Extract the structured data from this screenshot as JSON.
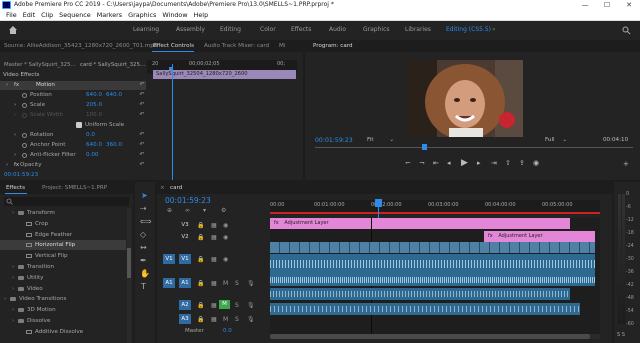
{
  "window": {
    "title": "Adobe Premiere Pro CC 2019 - C:\\Users\\jaypa\\Documents\\Adobe\\Premiere Pro\\13.0\\SMELLS~1.PRP.prproj *",
    "minimize": "—",
    "maximize": "☐",
    "close": "✕"
  },
  "menu": [
    "File",
    "Edit",
    "Clip",
    "Sequence",
    "Markers",
    "Graphics",
    "Window",
    "Help"
  ],
  "workspaces": [
    "Learning",
    "Assembly",
    "Editing",
    "Color",
    "Effects",
    "Audio",
    "Graphics",
    "Libraries",
    "Editing (CS5.5)"
  ],
  "source_panel": {
    "tabs": [
      "Source: AllieAddison_35423_1280x720_2600_T01.mp4",
      "Effect Controls",
      "Audio Track Mixer: card",
      "Mi"
    ],
    "master": "Master * SallySquirt_325...",
    "clip": "card * SallySquirt_325...",
    "time_start": "20",
    "time_mid": "00;00;02;05",
    "time_end": "00;",
    "clip_bar": "SallySquirt_32504_1280x720_2600",
    "section": "Video Effects",
    "fx_motion": "Motion",
    "position_label": "Position",
    "position_x": "640.0",
    "position_y": "640.0",
    "scale_label": "Scale",
    "scale_val": "205.0",
    "scale_width_label": "Scale Width",
    "scale_width_val": "100.0",
    "uniform_scale": "Uniform Scale",
    "rotation_label": "Rotation",
    "rotation_val": "0.0",
    "anchor_label": "Anchor Point",
    "anchor_x": "640.0",
    "anchor_y": "360.0",
    "flicker_label": "Anti-flicker Filter",
    "flicker_val": "0.00",
    "opacity_label": "Opacity",
    "timecode": "00:01:59:23"
  },
  "program_panel": {
    "title": "Program: card",
    "timecode": "00:01:59:23",
    "fit": "Fit",
    "quality": "Full",
    "duration": "00:04:10"
  },
  "effects_panel": {
    "tabs": [
      "Effects",
      "Project: SMELLS~1.PRP"
    ],
    "items": [
      {
        "label": "Transform",
        "level": 1,
        "folder": true
      },
      {
        "label": "Crop",
        "level": 2
      },
      {
        "label": "Edge Feather",
        "level": 2
      },
      {
        "label": "Horizontal Flip",
        "level": 2,
        "selected": true
      },
      {
        "label": "Vertical Flip",
        "level": 2
      },
      {
        "label": "Transition",
        "level": 1,
        "folder": true
      },
      {
        "label": "Utility",
        "level": 1,
        "folder": true
      },
      {
        "label": "Video",
        "level": 1,
        "folder": true
      },
      {
        "label": "Video Transitions",
        "level": 0,
        "folder": true
      },
      {
        "label": "3D Motion",
        "level": 1,
        "folder": true
      },
      {
        "label": "Dissolve",
        "level": 1,
        "folder": true
      },
      {
        "label": "Additive Dissolve",
        "level": 2
      }
    ]
  },
  "timeline": {
    "tab": "card",
    "timecode": "00:01:59:23",
    "ruler": [
      "00:00",
      "00:01:00:00",
      "00:02:00:00",
      "00:03:00:00",
      "00:04:00:00",
      "00:05:00:00"
    ],
    "tracks_video": [
      "V3",
      "V2",
      "V1"
    ],
    "tracks_audio": [
      "A1",
      "A2",
      "A3"
    ],
    "master": "Master",
    "master_val": "0.0",
    "src_v1": "V1",
    "src_a1": "A1",
    "adj_layer_1": "Adjustment Layer",
    "adj_layer_2": "Adjustment Layer",
    "fx": "fx"
  },
  "meter": {
    "labels": [
      "0",
      "-6",
      "-12",
      "-18",
      "-24",
      "-30",
      "-36",
      "-42",
      "-48",
      "-54",
      "-60"
    ],
    "s_label": "S S"
  },
  "colors": {
    "accent": "#2d8ceb",
    "adjustment_clip": "#e486d8",
    "video_clip": "#4f80a6",
    "audio_clip": "#2e6a8f",
    "panel_bg": "#232323"
  }
}
